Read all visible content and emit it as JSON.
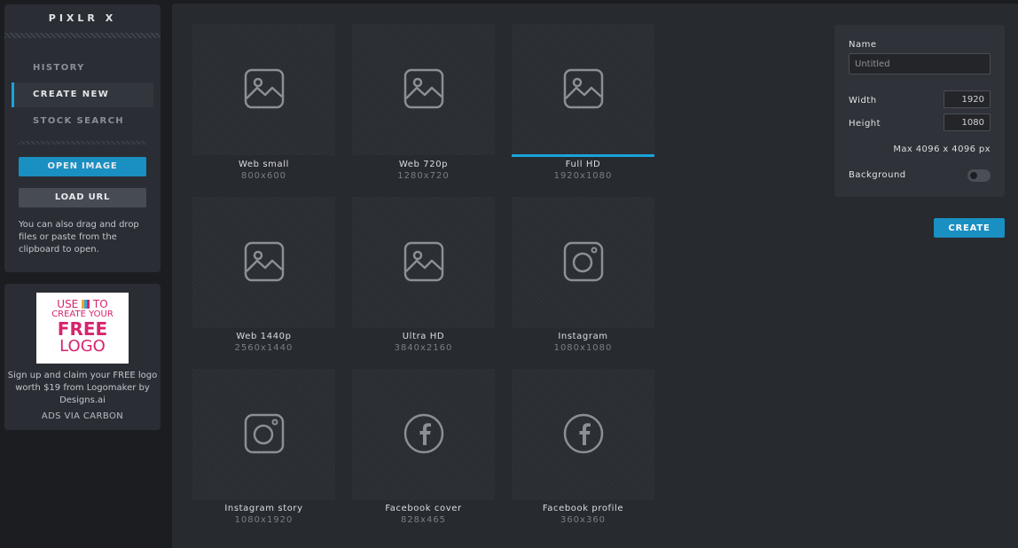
{
  "app": {
    "logo": "PIXLR X"
  },
  "sidebar": {
    "nav": [
      {
        "label": "HISTORY",
        "active": false
      },
      {
        "label": "CREATE NEW",
        "active": true
      },
      {
        "label": "STOCK SEARCH",
        "active": false
      }
    ],
    "open_image_label": "OPEN IMAGE",
    "load_url_label": "LOAD URL",
    "hint": "You can also drag and drop files or paste from the clipboard to open."
  },
  "ad": {
    "image_line1": "USE",
    "image_line1b": "TO",
    "image_line2": "CREATE YOUR",
    "image_line3": "FREE",
    "image_line4": "LOGO",
    "text": "Sign up and claim your FREE logo worth $19 from Logomaker by Designs.ai",
    "via": "ADS VIA CARBON"
  },
  "presets": [
    {
      "label": "Web small",
      "size": "800x600",
      "icon": "image-icon",
      "selected": false
    },
    {
      "label": "Web 720p",
      "size": "1280x720",
      "icon": "image-icon",
      "selected": false
    },
    {
      "label": "Full HD",
      "size": "1920x1080",
      "icon": "image-icon",
      "selected": true
    },
    {
      "label": "Web 1440p",
      "size": "2560x1440",
      "icon": "image-icon",
      "selected": false
    },
    {
      "label": "Ultra HD",
      "size": "3840x2160",
      "icon": "image-icon",
      "selected": false
    },
    {
      "label": "Instagram",
      "size": "1080x1080",
      "icon": "instagram-icon",
      "selected": false
    },
    {
      "label": "Instagram story",
      "size": "1080x1920",
      "icon": "instagram-icon",
      "selected": false
    },
    {
      "label": "Facebook cover",
      "size": "828x465",
      "icon": "facebook-icon",
      "selected": false
    },
    {
      "label": "Facebook profile",
      "size": "360x360",
      "icon": "facebook-icon",
      "selected": false
    }
  ],
  "properties": {
    "name_label": "Name",
    "name_placeholder": "Untitled",
    "width_label": "Width",
    "width_value": "1920",
    "height_label": "Height",
    "height_value": "1080",
    "max_text": "Max 4096 x 4096 px",
    "background_label": "Background",
    "background_on": false,
    "create_label": "CREATE"
  },
  "colors": {
    "accent": "#1aa3dc",
    "button_primary": "#1a8fc2",
    "button_secondary": "#474b53",
    "ad_pink": "#d6246e"
  }
}
